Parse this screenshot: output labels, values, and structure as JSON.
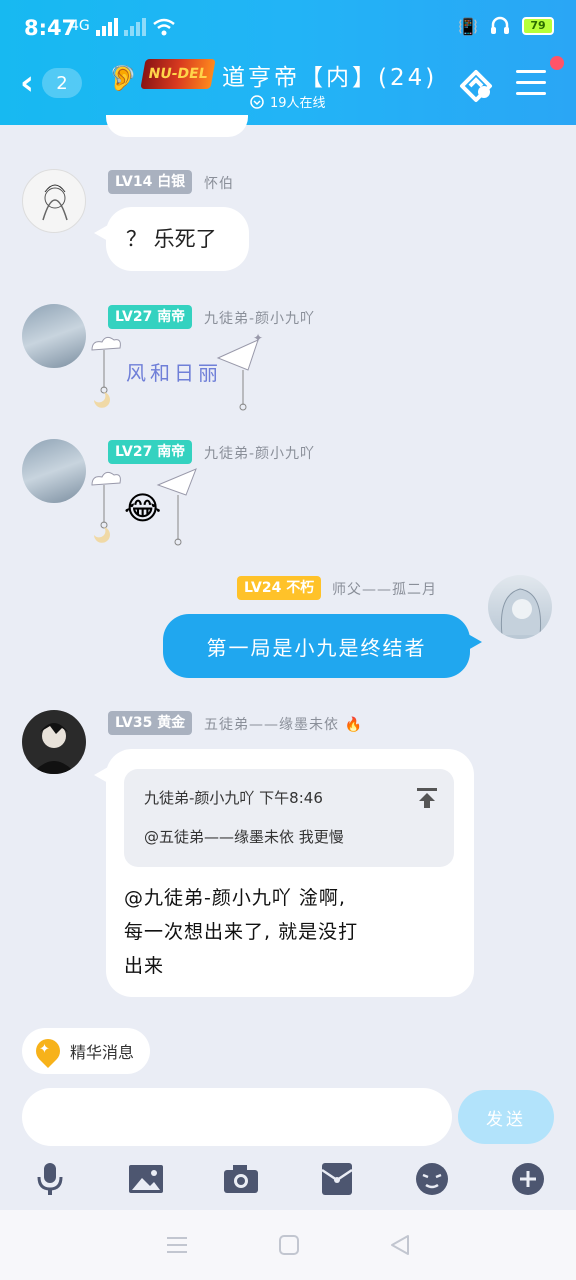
{
  "status_bar": {
    "time": "8:47",
    "battery": "79",
    "network_label": "4G"
  },
  "header": {
    "back_count": "2",
    "logo_text": "NU-DEL",
    "title": "道亨帝【内】(24)",
    "online_text": "19人在线"
  },
  "messages": [
    {
      "level": "LV14",
      "rank": "白银",
      "nick": "怀伯",
      "text": "？ 乐死了"
    },
    {
      "level": "LV27",
      "rank": "南帝",
      "nick": "九徒弟-颜小九吖",
      "text": "风和日丽"
    },
    {
      "level": "LV27",
      "rank": "南帝",
      "nick": "九徒弟-颜小九吖",
      "emoji": "😂"
    },
    {
      "level": "LV24",
      "rank": "不朽",
      "nick": "师父——孤二月",
      "text": "第一局是小九是终结者"
    },
    {
      "level": "LV35",
      "rank": "黄金",
      "nick": "五徒弟——缘墨未依",
      "nick_emoji": "🔥",
      "quote_author": "九徒弟-颜小九吖  下午8:46",
      "quote_text": "@五徒弟——缘墨未依 我更慢",
      "text_line1": "@九徒弟-颜小九吖 淦啊,",
      "text_line2": "每一次想出来了, 就是没打",
      "text_line3": "出来"
    }
  ],
  "essence_label": "精华消息",
  "send_label": "发送",
  "toolbar_icons": [
    "mic-icon",
    "image-icon",
    "camera-icon",
    "red-packet-icon",
    "emoji-icon",
    "plus-icon"
  ],
  "colors": {
    "header": "#22b4f6",
    "self_bubble": "#20a7ef",
    "teal_badge": "#34d2c0",
    "yellow_badge": "#ffc229",
    "grey_badge": "#a9b1bf"
  }
}
